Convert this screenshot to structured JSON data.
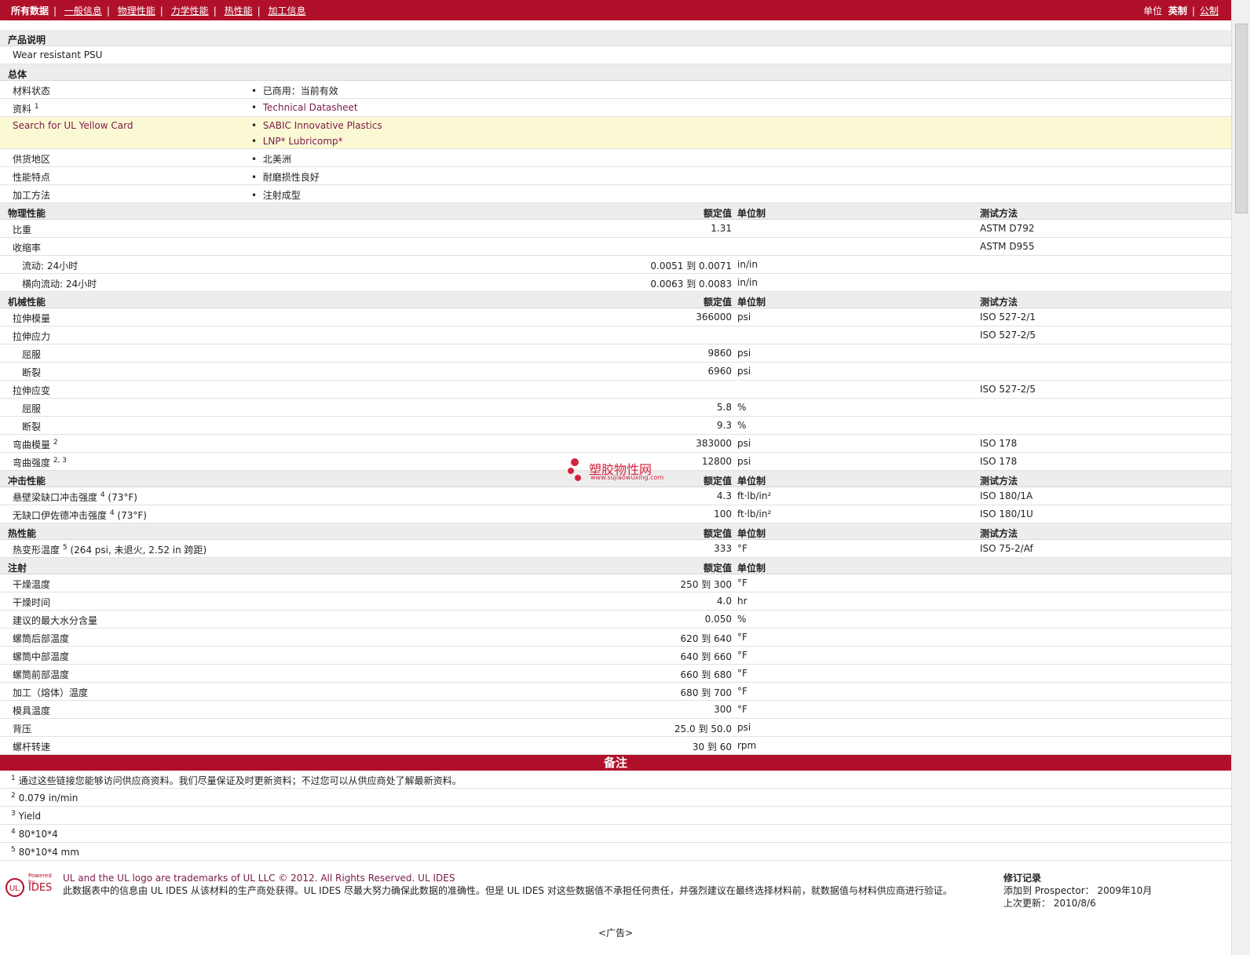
{
  "nav": {
    "tabs": [
      "所有数据",
      "一般信息",
      "物理性能",
      "力学性能",
      "热性能",
      "加工信息"
    ],
    "unit_label": "单位",
    "unit_imperial": "英制",
    "unit_metric": "公制"
  },
  "description": {
    "title": "产品说明",
    "text": "Wear resistant PSU"
  },
  "general": {
    "title": "总体",
    "material_status": {
      "label": "材料状态",
      "value": "已商用：当前有效"
    },
    "docs": {
      "label": "资料",
      "sup": "1",
      "value": "Technical Datasheet"
    },
    "ul": {
      "label": "Search for UL Yellow Card",
      "values": [
        "SABIC Innovative Plastics",
        "LNP* Lubricomp*"
      ]
    },
    "region": {
      "label": "供货地区",
      "value": "北美洲"
    },
    "features": {
      "label": "性能特点",
      "value": "耐磨损性良好"
    },
    "process": {
      "label": "加工方法",
      "value": "注射成型"
    }
  },
  "headers": {
    "value": "额定值",
    "unit": "单位制",
    "test": "测试方法"
  },
  "physical": {
    "title": "物理性能",
    "sg": {
      "label": "比重",
      "value": "1.31",
      "test": "ASTM D792"
    },
    "shrink": {
      "label": "收缩率",
      "test": "ASTM D955"
    },
    "flow": {
      "label": "流动: 24小时",
      "value": "0.0051 到  0.0071",
      "unit": "in/in"
    },
    "xflow": {
      "label": "横向流动: 24小时",
      "value": "0.0063 到  0.0083",
      "unit": "in/in"
    }
  },
  "mechanical": {
    "title": "机械性能",
    "tmod": {
      "label": "拉伸模量",
      "value": "366000",
      "unit": "psi",
      "test": "ISO 527-2/1"
    },
    "tstress": {
      "label": "拉伸应力",
      "test": "ISO 527-2/5"
    },
    "ts_yield": {
      "label": "屈服",
      "value": "9860",
      "unit": "psi"
    },
    "ts_break": {
      "label": "断裂",
      "value": "6960",
      "unit": "psi"
    },
    "tstrain": {
      "label": "拉伸应变",
      "test": "ISO 527-2/5"
    },
    "te_yield": {
      "label": "屈服",
      "value": "5.8",
      "unit": "%"
    },
    "te_break": {
      "label": "断裂",
      "value": "9.3",
      "unit": "%"
    },
    "fmod": {
      "label": "弯曲模量",
      "sup": "2",
      "value": "383000",
      "unit": "psi",
      "test": "ISO 178"
    },
    "fstr": {
      "label": "弯曲强度",
      "sup": "2, 3",
      "value": "12800",
      "unit": "psi",
      "test": "ISO 178"
    }
  },
  "impact": {
    "title": "冲击性能",
    "izod": {
      "label": "悬壁梁缺口冲击强度",
      "sup": "4",
      "cond": " (73°F)",
      "value": "4.3",
      "unit": "ft·lb/in²",
      "test": "ISO 180/1A"
    },
    "izod_un": {
      "label": "无缺口伊佐德冲击强度",
      "sup": "4",
      "cond": " (73°F)",
      "value": "100",
      "unit": "ft·lb/in²",
      "test": "ISO 180/1U"
    }
  },
  "thermal": {
    "title": "热性能",
    "hdt": {
      "label": "热变形温度",
      "sup": "5",
      "cond": " (264 psi, 未退火, 2.52 in 跨距)",
      "value": "333",
      "unit": "°F",
      "test": "ISO 75-2/Af"
    }
  },
  "injection": {
    "title": "注射",
    "rows": [
      {
        "label": "干燥温度",
        "value": "250 到  300",
        "unit": "°F"
      },
      {
        "label": "干燥时间",
        "value": "4.0",
        "unit": "hr"
      },
      {
        "label": "建议的最大水分含量",
        "value": "0.050",
        "unit": "%"
      },
      {
        "label": "螺筒后部温度",
        "value": "620 到  640",
        "unit": "°F"
      },
      {
        "label": "螺筒中部温度",
        "value": "640 到  660",
        "unit": "°F"
      },
      {
        "label": "螺筒前部温度",
        "value": "660 到  680",
        "unit": "°F"
      },
      {
        "label": "加工（熔体）温度",
        "value": "680 到  700",
        "unit": "°F"
      },
      {
        "label": "模具温度",
        "value": "300",
        "unit": "°F"
      },
      {
        "label": "背压",
        "value": "25.0 到  50.0",
        "unit": "psi"
      },
      {
        "label": "螺杆转速",
        "value": "30 到  60",
        "unit": "rpm"
      }
    ]
  },
  "notes": {
    "title": "备注",
    "items": [
      {
        "n": "1",
        "text": "通过这些链接您能够访问供应商资料。我们尽量保证及时更新资料；不过您可以从供应商处了解最新资料。"
      },
      {
        "n": "2",
        "text": "0.079 in/min"
      },
      {
        "n": "3",
        "text": "Yield"
      },
      {
        "n": "4",
        "text": "80*10*4"
      },
      {
        "n": "5",
        "text": "80*10*4 mm"
      }
    ]
  },
  "footer": {
    "logo_powered": "Powered by",
    "logo_ul": "UL",
    "logo_ides": "IDES",
    "line1": "UL and the UL logo are trademarks of UL LLC © 2012. All Rights Reserved. UL IDES",
    "line2": "此数据表中的信息由  UL IDES 从该材料的生产商处获得。UL IDES 尽最大努力确保此数据的准确性。但是  UL IDES 对这些数据值不承担任何责任，并强烈建议在最终选择材料前，就数据值与材料供应商进行验证。",
    "rev_title": "修订记录",
    "added": "添加到  Prospector：  2009年10月",
    "updated": "上次更新：  2010/8/6"
  },
  "ad": "<广告>",
  "watermark": {
    "cn": "塑胶物性网",
    "url": "www.sujiaowuxing.com"
  }
}
